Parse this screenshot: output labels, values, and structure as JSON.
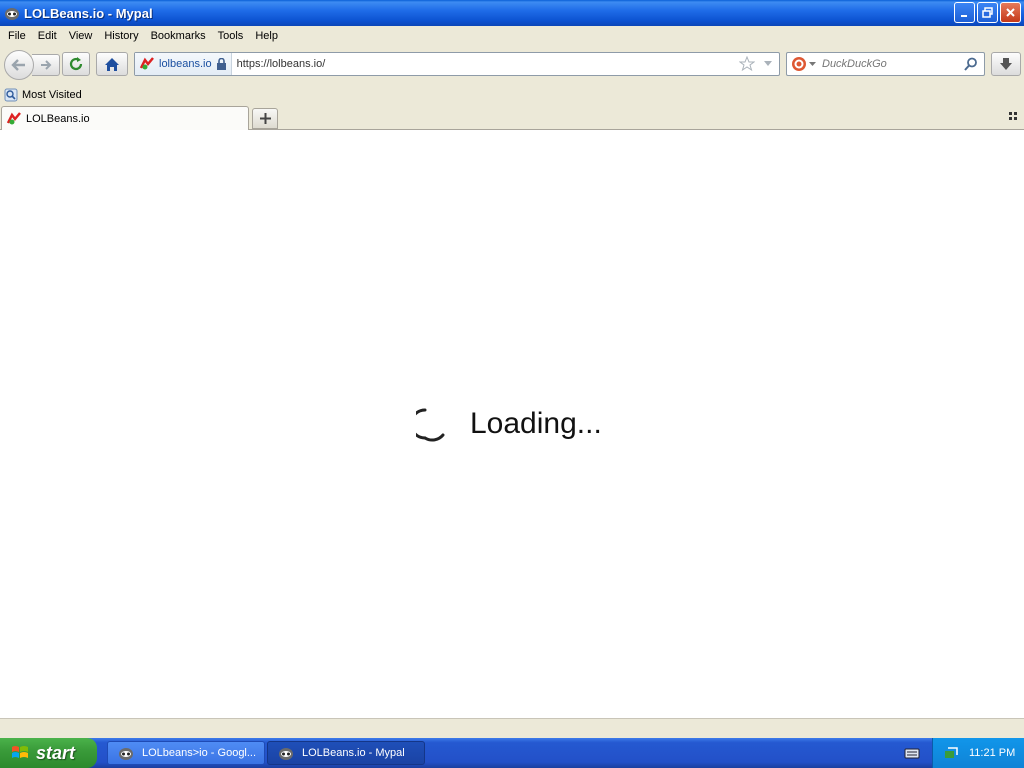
{
  "window": {
    "title": "LOLBeans.io - Mypal"
  },
  "menu": {
    "items": [
      {
        "label": "File"
      },
      {
        "label": "Edit"
      },
      {
        "label": "View"
      },
      {
        "label": "History"
      },
      {
        "label": "Bookmarks"
      },
      {
        "label": "Tools"
      },
      {
        "label": "Help"
      }
    ]
  },
  "navbar": {
    "identity_label": "lolbeans.io",
    "url": "https://lolbeans.io/",
    "search_placeholder": "DuckDuckGo"
  },
  "bookmarks": {
    "items": [
      {
        "label": "Most Visited"
      }
    ]
  },
  "tabs": {
    "items": [
      {
        "label": "LOLBeans.io",
        "active": true
      }
    ]
  },
  "page": {
    "loading_text": "Loading..."
  },
  "taskbar": {
    "start_label": "start",
    "tasks": [
      {
        "label": "LOLbeans>io - Googl...",
        "active": false
      },
      {
        "label": "LOLBeans.io - Mypal",
        "active": true
      }
    ],
    "clock": "11:21 PM"
  },
  "colors": {
    "titlebar": "#0c52d1",
    "taskbar": "#2350c8",
    "start": "#3a9c3a",
    "tray": "#0f83d6"
  }
}
